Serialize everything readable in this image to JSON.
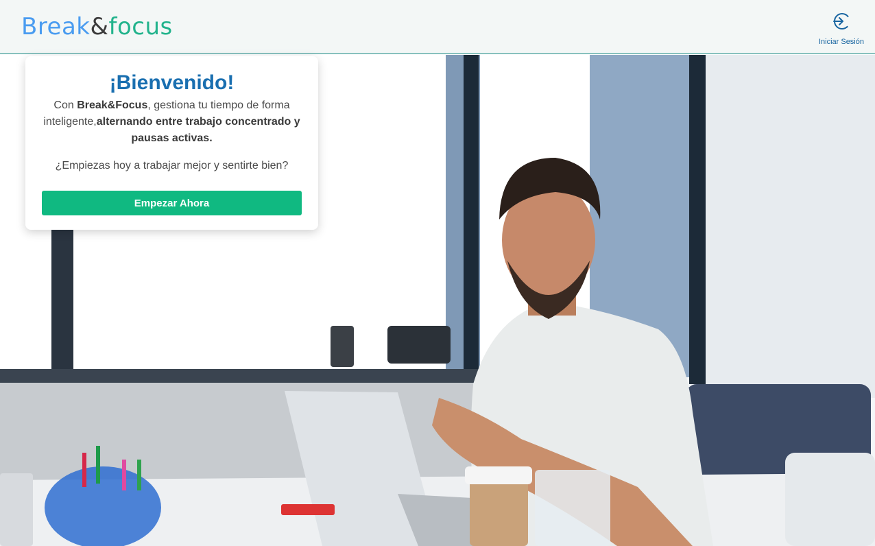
{
  "header": {
    "logo": {
      "part1": "Break",
      "part2": "&",
      "part3": "focus"
    },
    "login": {
      "label": "Iniciar Sesión",
      "icon": "login-icon"
    }
  },
  "welcome": {
    "title": "¡Bienvenido!",
    "desc_prefix": "Con ",
    "desc_brand": "Break&Focus",
    "desc_mid": ", gestiona tu tiempo de forma inteligente,",
    "desc_bold": "alternando entre trabajo concentrado y pausas activas.",
    "question": "¿Empiezas hoy a trabajar mejor y sentirte bien?",
    "cta_label": "Empezar Ahora"
  },
  "colors": {
    "brand_blue": "#4a9cf0",
    "brand_green": "#22b38c",
    "title_blue": "#1a6fb0",
    "cta_green": "#10b981",
    "header_border": "#1a8a85"
  }
}
